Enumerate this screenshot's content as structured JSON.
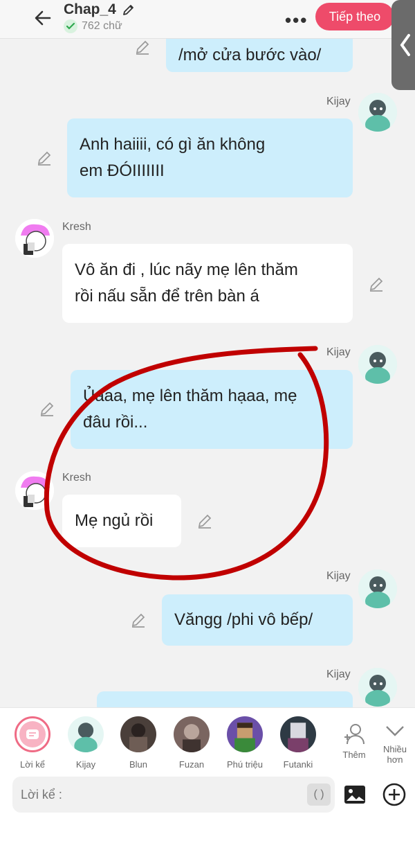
{
  "header": {
    "title": "Chap_4",
    "word_count": "762 chữ",
    "next_label": "Tiếp theo",
    "more_label": "•••"
  },
  "messages": [
    {
      "speaker": "",
      "text_lines": [
        "/mở cửa bước vào/"
      ],
      "side": "right",
      "style": "blue"
    },
    {
      "speaker": "Kijay",
      "text_lines": [
        "Anh haiiii, có gì ăn không",
        "em ĐÓIIIIIII"
      ],
      "side": "right",
      "style": "blue"
    },
    {
      "speaker": "Kresh",
      "text_lines": [
        "Vô ăn đi , lúc nãy mẹ lên thăm",
        "rồi nấu sẵn để trên bàn á"
      ],
      "side": "left",
      "style": "white"
    },
    {
      "speaker": "Kijay",
      "text_lines": [
        "Ủaaa, mẹ lên thăm hạaa, mẹ",
        "đâu rồi..."
      ],
      "side": "right",
      "style": "blue"
    },
    {
      "speaker": "Kresh",
      "text_lines": [
        "Mẹ ngủ rồi"
      ],
      "side": "left",
      "style": "white"
    },
    {
      "speaker": "Kijay",
      "text_lines": [
        "Văngg /phi vô bếp/"
      ],
      "side": "right",
      "style": "blue"
    },
    {
      "speaker": "Kijay",
      "text_lines": [
        ""
      ],
      "side": "right",
      "style": "blue"
    }
  ],
  "characters": [
    {
      "label": "Lời kể",
      "icon": "narration-icon",
      "selected": true
    },
    {
      "label": "Kijay",
      "icon": "avatar"
    },
    {
      "label": "Blun",
      "icon": "avatar"
    },
    {
      "label": "Fuzan",
      "icon": "avatar"
    },
    {
      "label": "Phú triệu",
      "icon": "avatar"
    },
    {
      "label": "Futanki",
      "icon": "avatar"
    },
    {
      "label": "Thêm",
      "icon": "add-person-icon"
    },
    {
      "label": "Nhiều hơn",
      "icon": "chevron-down-icon"
    }
  ],
  "input": {
    "placeholder": "Lời kể :",
    "paren_label": "( )"
  },
  "colors": {
    "accent": "#ee4b6a",
    "bubble_blue": "#cdeefc",
    "annotation_red": "#c00000"
  }
}
